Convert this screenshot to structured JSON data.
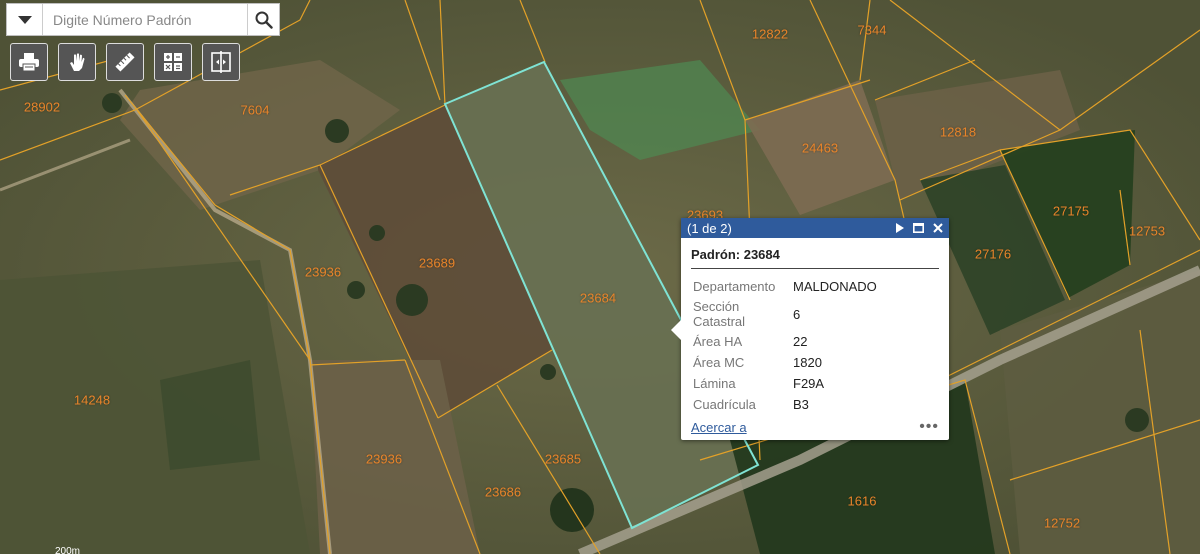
{
  "search": {
    "placeholder": "Digite Número Padrón",
    "value": "",
    "dropdown_icon": "chevron-down-icon",
    "submit_icon": "search-icon"
  },
  "toolbar": [
    {
      "name": "print",
      "icon": "printer-icon"
    },
    {
      "name": "select",
      "icon": "hand-pointer-icon"
    },
    {
      "name": "measure",
      "icon": "ruler-icon"
    },
    {
      "name": "calculator",
      "icon": "calculator-icon"
    },
    {
      "name": "swipe",
      "icon": "split-view-icon"
    }
  ],
  "map": {
    "parcel_labels": [
      "7604",
      "28902",
      "12822",
      "7344",
      "12818",
      "24463",
      "23689",
      "23936",
      "14248",
      "23684",
      "23693",
      "27176",
      "27175",
      "12753",
      "23685",
      "23686",
      "23936",
      "1616",
      "12752"
    ],
    "selected_parcel": "23684",
    "parcel_line_color": "#e3a128",
    "selection_color": "#7fe3d4",
    "scale_text": "200m"
  },
  "popup": {
    "pager": "(1 de 2)",
    "title": "Padrón: 23684",
    "fields": [
      {
        "key": "Departamento",
        "value": "MALDONADO"
      },
      {
        "key": "Sección Catastral",
        "value": "6"
      },
      {
        "key": "Área HA",
        "value": "22"
      },
      {
        "key": "Área MC",
        "value": "1820"
      },
      {
        "key": "Lámina",
        "value": "F29A"
      },
      {
        "key": "Cuadrícula",
        "value": "B3"
      }
    ],
    "zoom_link": "Acercar a",
    "more_label": "•••",
    "header_color": "#2f5b9c"
  }
}
